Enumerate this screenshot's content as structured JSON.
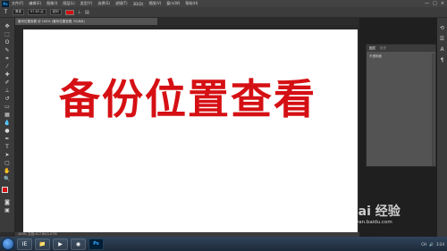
{
  "app": {
    "logo": "Ps",
    "menu": [
      "文件(F)",
      "编辑(E)",
      "图像(I)",
      "图层(L)",
      "类型(Y)",
      "选择(S)",
      "滤镜(T)",
      "3D(D)",
      "视图(V)",
      "窗口(W)",
      "帮助(H)"
    ],
    "window_controls": [
      "—",
      "□",
      "×"
    ]
  },
  "options": {
    "tool_glyph": "T",
    "font_family": "黑体",
    "font_size": "97.83 点",
    "antialias": "锐利",
    "text_color": "#d51014"
  },
  "document": {
    "tab_title": "备份位置查看 @ 100% (备份位置查看, RGB/8)"
  },
  "canvas": {
    "headline": "备份位置查看",
    "headline_color": "#d51014"
  },
  "status": {
    "zoom": "100%",
    "doc_info": "文档:417.8K/1.07M"
  },
  "panel": {
    "tabs": [
      "图层",
      "历史"
    ],
    "body": "不透明度"
  },
  "watermark": {
    "main": "Bai 经验",
    "url": "jingyan.baidu.com"
  },
  "taskbar": {
    "items": [
      "IE",
      "📁",
      "▶",
      "◉",
      "Ps"
    ],
    "tray": [
      "CH",
      "🔊",
      "3:24"
    ]
  }
}
